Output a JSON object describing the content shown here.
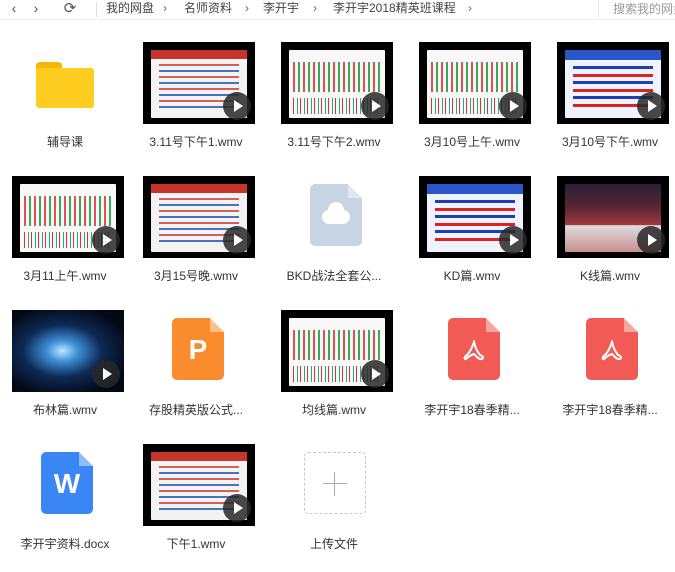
{
  "toolbar": {
    "back_icon": "chevron-left-icon",
    "forward_icon": "chevron-right-icon",
    "refresh_icon": "refresh-icon",
    "breadcrumb": [
      "我的网盘",
      "名师资料",
      "李开宇",
      "李开宇2018精英班课程"
    ],
    "search_placeholder": "搜索我的网盘文件"
  },
  "files": [
    {
      "name": "辅导课",
      "kind": "folder"
    },
    {
      "name": "3.11号下午1.wmv",
      "kind": "video"
    },
    {
      "name": "3.11号下午2.wmv",
      "kind": "video"
    },
    {
      "name": "3月10号上午.wmv",
      "kind": "video"
    },
    {
      "name": "3月10号下午.wmv",
      "kind": "video"
    },
    {
      "name": "3月11上午.wmv",
      "kind": "video"
    },
    {
      "name": "3月15号晚.wmv",
      "kind": "video"
    },
    {
      "name": "BKD战法全套公...",
      "kind": "cloud-file"
    },
    {
      "name": "KD篇.wmv",
      "kind": "video"
    },
    {
      "name": "K线篇.wmv",
      "kind": "video"
    },
    {
      "name": "布林篇.wmv",
      "kind": "video"
    },
    {
      "name": "存股精英版公式...",
      "kind": "ppt",
      "icon_letter": "P"
    },
    {
      "name": "均线篇.wmv",
      "kind": "video"
    },
    {
      "name": "李开宇18春季精...",
      "kind": "pdf"
    },
    {
      "name": "李开宇18春季精...",
      "kind": "pdf"
    },
    {
      "name": "李开宇资料.docx",
      "kind": "word",
      "icon_letter": "W"
    },
    {
      "name": "下午1.wmv",
      "kind": "video"
    }
  ],
  "upload": {
    "label": "上传文件"
  },
  "colors": {
    "folder": "#ffcd1f",
    "pdf": "#f25a55",
    "ppt": "#fb8c2d",
    "word": "#3a86f4",
    "cloud": "#c7d4e4"
  }
}
